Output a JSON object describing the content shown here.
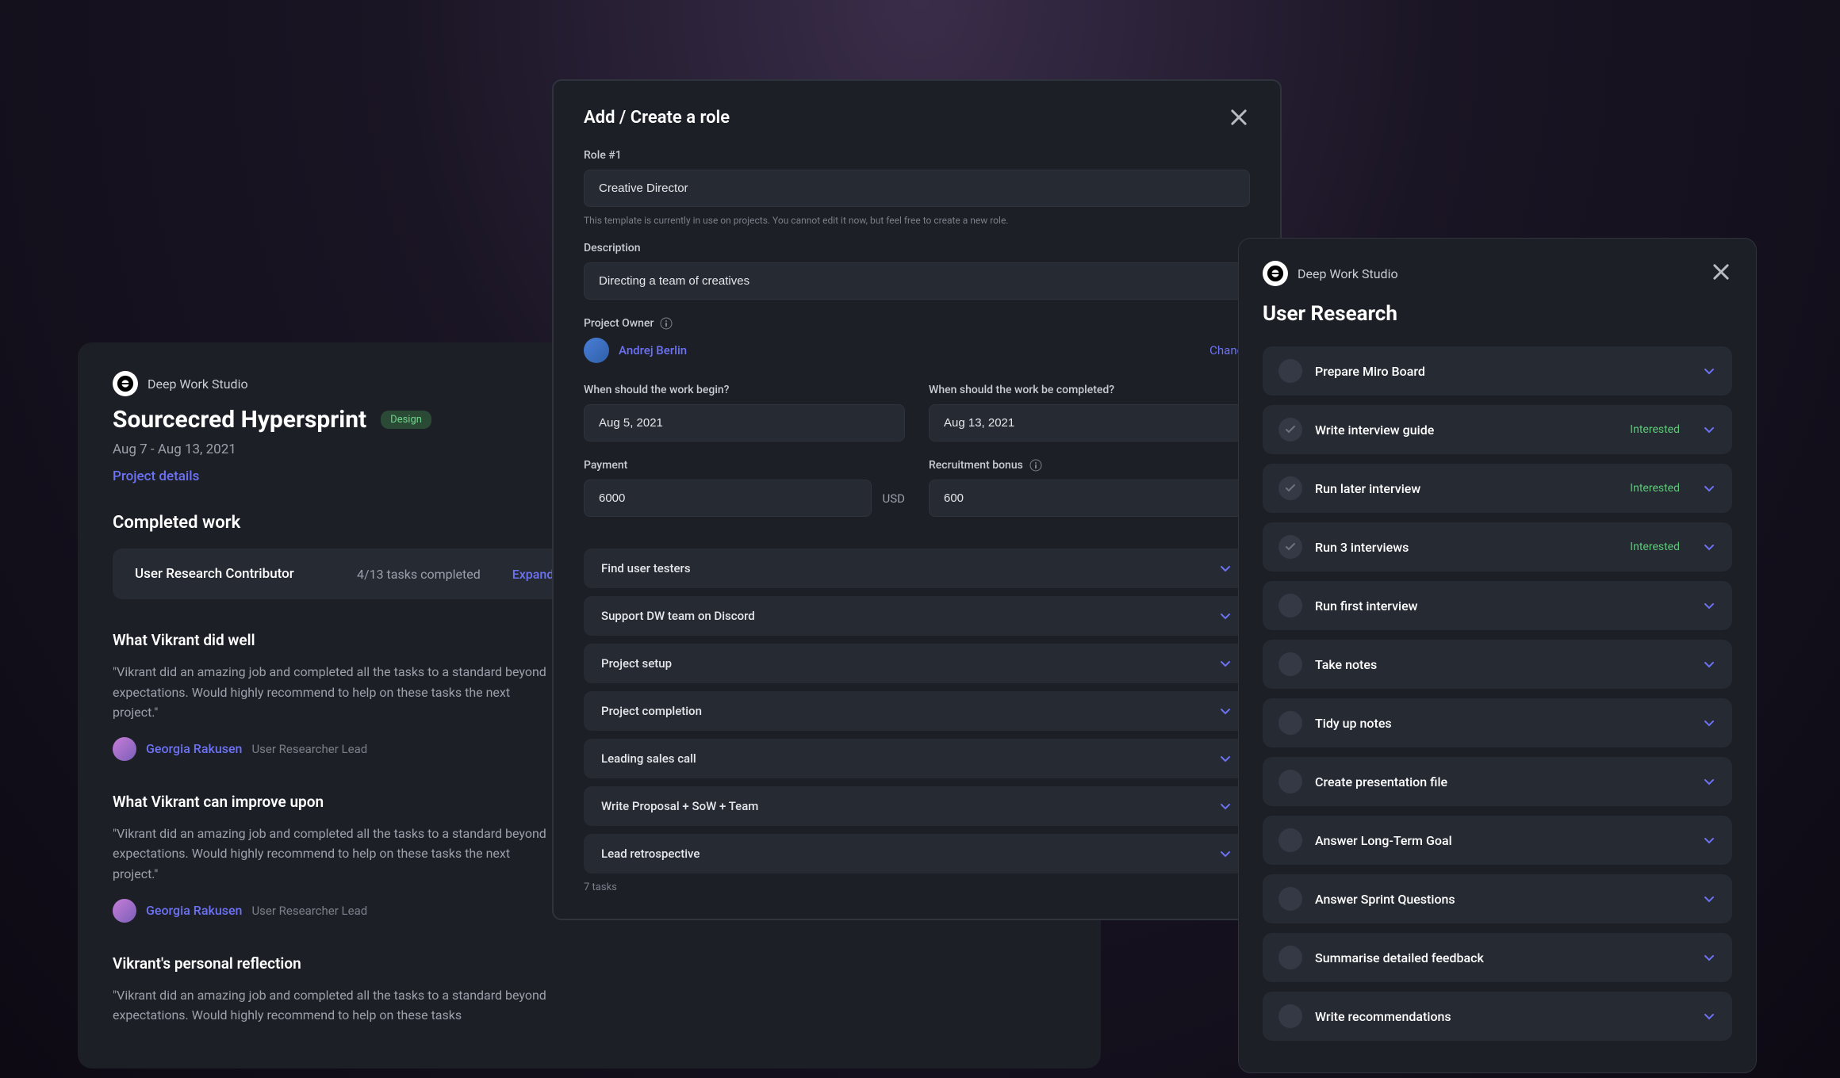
{
  "org": {
    "name": "Deep Work Studio"
  },
  "bgCard": {
    "projectTitle": "Sourcecred Hypersprint",
    "badge": "Design",
    "dateRange": "Aug 7 - Aug 13, 2021",
    "detailsLink": "Project details",
    "completedWorkHeading": "Completed work",
    "role": {
      "name": "User Research Contributor",
      "tasks": "4/13 tasks completed",
      "expand": "Expand"
    },
    "feedback": [
      {
        "heading": "What Vikrant did well",
        "quote": "\"Vikrant did an amazing job and completed all the tasks to a standard beyond expectations. Would highly recommend to help on these tasks the next project.\"",
        "author": "Georgia Rakusen",
        "authorRole": "User Researcher Lead"
      },
      {
        "heading": "What Vikrant can improve upon",
        "quote": "\"Vikrant did an amazing job and completed all the tasks to a standard beyond expectations. Would highly recommend to help on these tasks the next project.\"",
        "author": "Georgia Rakusen",
        "authorRole": "User Researcher Lead"
      },
      {
        "heading": "Vikrant's personal reflection",
        "quote": "\"Vikrant did an amazing job and completed all the tasks to a standard beyond expectations. Would highly recommend to help on these tasks"
      }
    ]
  },
  "modal": {
    "title": "Add / Create a role",
    "roleLabel": "Role #1",
    "roleValue": "Creative Director",
    "roleHint": "This template is currently in use on projects. You cannot edit it now, but feel free to create a new role.",
    "descLabel": "Description",
    "descValue": "Directing a team of creatives",
    "ownerLabel": "Project Owner",
    "ownerName": "Andrej Berlin",
    "changeLabel": "Change",
    "beginLabel": "When should the work begin?",
    "beginValue": "Aug 5, 2021",
    "endLabel": "When should the work be completed?",
    "endValue": "Aug 13, 2021",
    "paymentLabel": "Payment",
    "paymentValue": "6000",
    "currency": "USD",
    "bonusLabel": "Recruitment bonus",
    "bonusValue": "600",
    "tasks": [
      "Find user testers",
      "Support DW team on Discord",
      "Project setup",
      "Project completion",
      "Leading sales call",
      "Write Proposal + SoW + Team",
      "Lead retrospective"
    ],
    "taskCount": "7 tasks"
  },
  "rightPanel": {
    "title": "User Research",
    "tasks": [
      {
        "name": "Prepare Miro Board",
        "done": false,
        "status": ""
      },
      {
        "name": "Write interview guide",
        "done": true,
        "status": "Interested"
      },
      {
        "name": "Run later interview",
        "done": true,
        "status": "Interested"
      },
      {
        "name": "Run 3 interviews",
        "done": true,
        "status": "Interested"
      },
      {
        "name": "Run first interview",
        "done": false,
        "status": ""
      },
      {
        "name": "Take notes",
        "done": false,
        "status": ""
      },
      {
        "name": "Tidy up notes",
        "done": false,
        "status": ""
      },
      {
        "name": "Create presentation file",
        "done": false,
        "status": ""
      },
      {
        "name": "Answer Long-Term Goal",
        "done": false,
        "status": ""
      },
      {
        "name": "Answer Sprint Questions",
        "done": false,
        "status": ""
      },
      {
        "name": "Summarise detailed feedback",
        "done": false,
        "status": ""
      },
      {
        "name": "Write recommendations",
        "done": false,
        "status": ""
      }
    ]
  }
}
